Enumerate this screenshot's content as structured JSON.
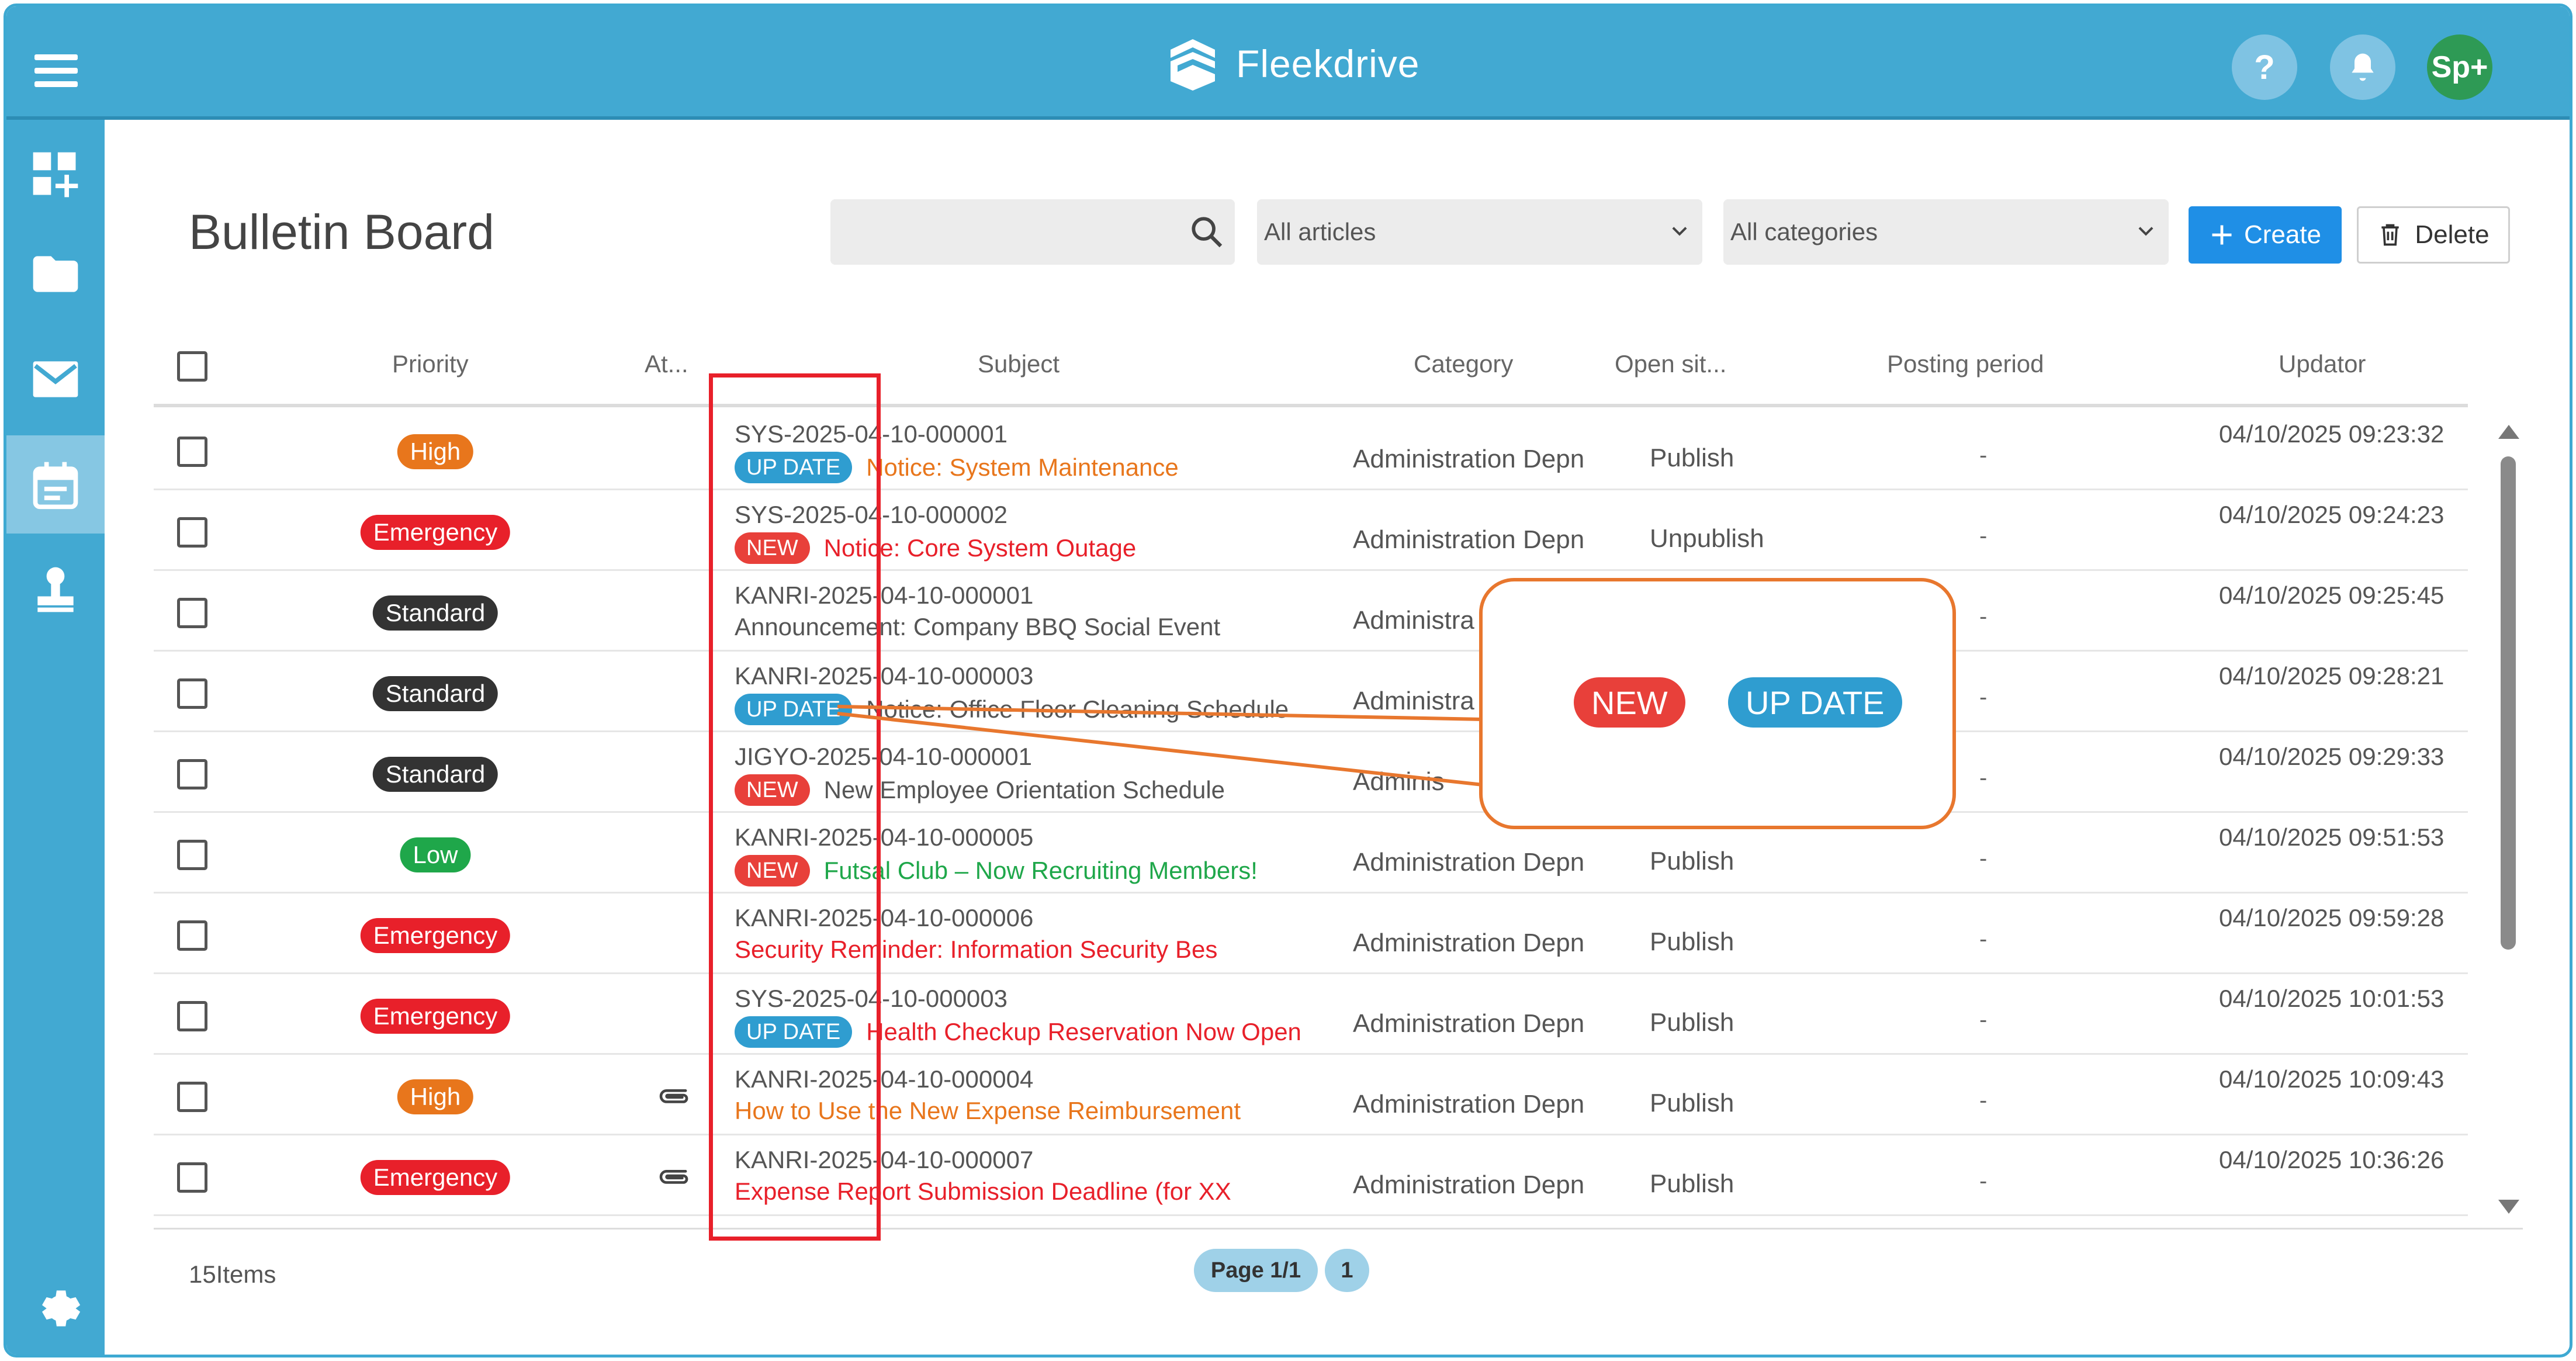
{
  "app": {
    "name": "Fleekdrive"
  },
  "header": {
    "help_label": "?",
    "user_label": "Sp+"
  },
  "page": {
    "title": "Bulletin Board"
  },
  "search": {
    "placeholder": ""
  },
  "filters": {
    "articles": "All articles",
    "categories": "All categories"
  },
  "toolbar": {
    "create_label": "Create",
    "delete_label": "Delete"
  },
  "table": {
    "headers": [
      "Priority",
      "At...",
      "Subject",
      "Category",
      "Open sit...",
      "Posting period",
      "Updator"
    ],
    "rows": [
      {
        "priority": "High",
        "prio_color": "#e8761c",
        "attach": false,
        "id": "SYS-2025-04-10-000001",
        "badge": "UP DATE",
        "badge_color": "#2f9dd0",
        "title": "Notice: System Maintenance",
        "title_color": "#e8761c",
        "category": "Administration Depn",
        "open": "Publish",
        "posting": "-",
        "updated": "04/10/2025 09:23:32"
      },
      {
        "priority": "Emergency",
        "prio_color": "#e8202a",
        "attach": false,
        "id": "SYS-2025-04-10-000002",
        "badge": "NEW",
        "badge_color": "#e8403a",
        "title": "Notice: Core System Outage",
        "title_color": "#e8202a",
        "category": "Administration Depn",
        "open": "Unpublish",
        "posting": "-",
        "updated": "04/10/2025 09:24:23"
      },
      {
        "priority": "Standard",
        "prio_color": "#333333",
        "attach": false,
        "id": "KANRI-2025-04-10-000001",
        "badge": "",
        "badge_color": "",
        "title": "Announcement: Company BBQ Social Event",
        "title_color": "#555555",
        "category": "Administra",
        "open": "",
        "posting": "-",
        "updated": "04/10/2025 09:25:45"
      },
      {
        "priority": "Standard",
        "prio_color": "#333333",
        "attach": false,
        "id": "KANRI-2025-04-10-000003",
        "badge": "UP DATE",
        "badge_color": "#2f9dd0",
        "title": "Notice: Office Floor Cleaning Schedule",
        "title_color": "#555555",
        "category": "Administra",
        "open": "",
        "posting": "-",
        "updated": "04/10/2025 09:28:21"
      },
      {
        "priority": "Standard",
        "prio_color": "#333333",
        "attach": false,
        "id": "JIGYO-2025-04-10-000001",
        "badge": "NEW",
        "badge_color": "#e8403a",
        "title": "New Employee Orientation Schedule",
        "title_color": "#555555",
        "category": "Adminis",
        "open": "",
        "posting": "-",
        "updated": "04/10/2025 09:29:33"
      },
      {
        "priority": "Low",
        "prio_color": "#1fa74a",
        "attach": false,
        "id": "KANRI-2025-04-10-000005",
        "badge": "NEW",
        "badge_color": "#e8403a",
        "title": "Futsal Club – Now Recruiting Members!",
        "title_color": "#1fa74a",
        "category": "Administration Depn",
        "open": "Publish",
        "posting": "-",
        "updated": "04/10/2025 09:51:53"
      },
      {
        "priority": "Emergency",
        "prio_color": "#e8202a",
        "attach": false,
        "id": "KANRI-2025-04-10-000006",
        "badge": "",
        "badge_color": "",
        "title": "Security Reminder: Information Security Bes",
        "title_color": "#e8202a",
        "category": "Administration Depn",
        "open": "Publish",
        "posting": "-",
        "updated": "04/10/2025 09:59:28"
      },
      {
        "priority": "Emergency",
        "prio_color": "#e8202a",
        "attach": false,
        "id": "SYS-2025-04-10-000003",
        "badge": "UP DATE",
        "badge_color": "#2f9dd0",
        "title": "Health Checkup Reservation Now Open",
        "title_color": "#e8202a",
        "category": "Administration Depn",
        "open": "Publish",
        "posting": "-",
        "updated": "04/10/2025 10:01:53"
      },
      {
        "priority": "High",
        "prio_color": "#e8761c",
        "attach": true,
        "id": "KANRI-2025-04-10-000004",
        "badge": "",
        "badge_color": "",
        "title": "How to Use the New Expense Reimbursement",
        "title_color": "#e8761c",
        "category": "Administration Depn",
        "open": "Publish",
        "posting": "-",
        "updated": "04/10/2025 10:09:43"
      },
      {
        "priority": "Emergency",
        "prio_color": "#e8202a",
        "attach": true,
        "id": "KANRI-2025-04-10-000007",
        "badge": "",
        "badge_color": "",
        "title": "Expense Report Submission Deadline (for XX",
        "title_color": "#e8202a",
        "category": "Administration Depn",
        "open": "Publish",
        "posting": "-",
        "updated": "04/10/2025 10:36:26"
      }
    ]
  },
  "footer": {
    "items_count": "15Items",
    "page_label": "Page 1/1",
    "page_number": "1"
  },
  "callout": {
    "new_label": "NEW",
    "update_label": "UP DATE"
  },
  "colors": {
    "header": "#42a9d2",
    "accent": "#1f8fe6",
    "annotation_box": "#e8202a",
    "callout_border": "#e8772e"
  },
  "sidebar": {
    "icons": [
      "dashboard-add-icon",
      "folder-icon",
      "mail-icon",
      "calendar-icon",
      "stamp-icon",
      "settings-icon"
    ]
  }
}
